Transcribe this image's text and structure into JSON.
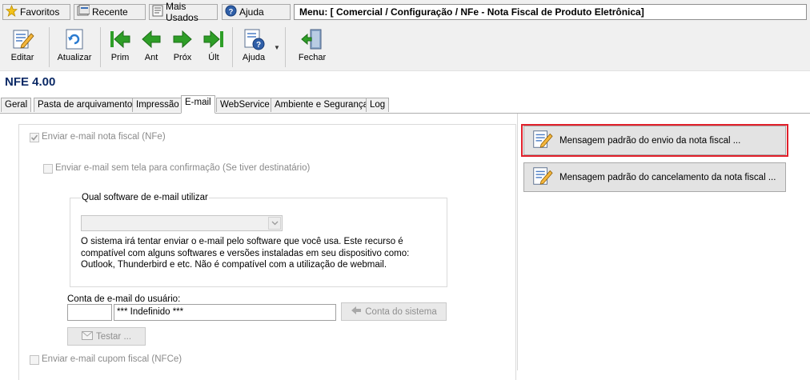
{
  "quickbar": {
    "favoritos": "Favoritos",
    "recente": "Recente",
    "mais_usados": "Mais Usados",
    "ajuda": "Ajuda",
    "menu_path": "Menu: [ Comercial / Configuração / NFe - Nota Fiscal de Produto Eletrônica]"
  },
  "toolbar": {
    "editar": "Editar",
    "atualizar": "Atualizar",
    "prim": "Prim",
    "ant": "Ant",
    "prox": "Próx",
    "ult": "Últ",
    "ajuda": "Ajuda",
    "fechar": "Fechar"
  },
  "title": "NFE 4.00",
  "tabs": [
    "Geral",
    "Pasta de arquivamento",
    "Impressão",
    "E-mail",
    "WebService",
    "Ambiente e Segurança",
    "Log"
  ],
  "active_tab": "E-mail",
  "email": {
    "enviar_nfe": "Enviar e-mail nota fiscal (NFe)",
    "enviar_sem_tela": "Enviar e-mail sem tela para confirmação (Se tiver destinatário)",
    "software_group": "Qual software de e-mail utilizar",
    "software_value": "",
    "description": "O sistema irá tentar enviar o e-mail pelo software que você usa. Este recurso é compatível com alguns softwares e versões instaladas em seu dispositivo como: Outlook, Thunderbird e etc. Não é compatível com a utilização de webmail.",
    "conta_label": "Conta de e-mail do usuário:",
    "conta_code": "",
    "conta_value": "*** Indefinido ***",
    "conta_sistema": "Conta do sistema",
    "testar": "Testar ...",
    "enviar_nfce": "Enviar e-mail cupom fiscal (NFCe)"
  },
  "buttons": {
    "msg_envio": "Mensagem padrão do envio da nota fiscal ...",
    "msg_cancelamento": "Mensagem padrão do cancelamento da nota fiscal ..."
  },
  "colors": {
    "highlight": "#e1202a",
    "title": "#0c2a66",
    "green_nav": "#2e9e27"
  }
}
